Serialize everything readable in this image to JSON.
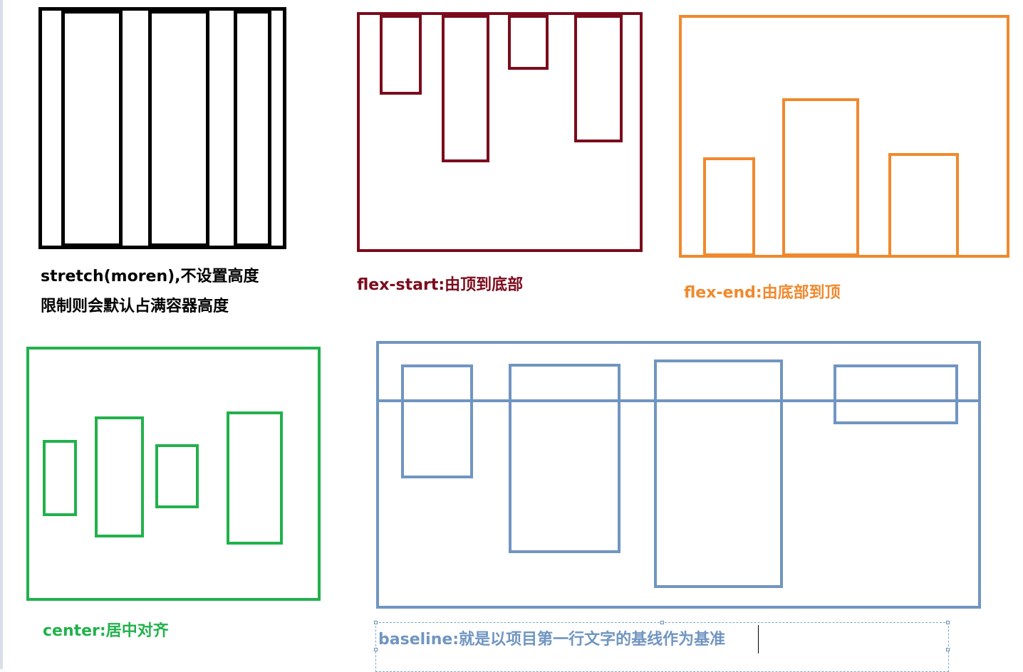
{
  "colors": {
    "stretch": "#000000",
    "flex_start": "#7b0b1c",
    "flex_end": "#f0892e",
    "center": "#22b14c",
    "baseline": "#7095c1",
    "textbox_border": "#7aa8c8"
  },
  "captions": {
    "stretch_line1": "stretch(moren),不设置高度",
    "stretch_line2": "限制则会默认占满容器高度",
    "flex_start": "flex-start:由顶到底部",
    "flex_end": "flex-end:由底部到顶",
    "center": "center:居中对齐",
    "baseline": "baseline:就是以项目第一行文字的基线作为基准"
  },
  "panels": [
    "stretch",
    "flex-start",
    "flex-end",
    "center",
    "baseline"
  ]
}
